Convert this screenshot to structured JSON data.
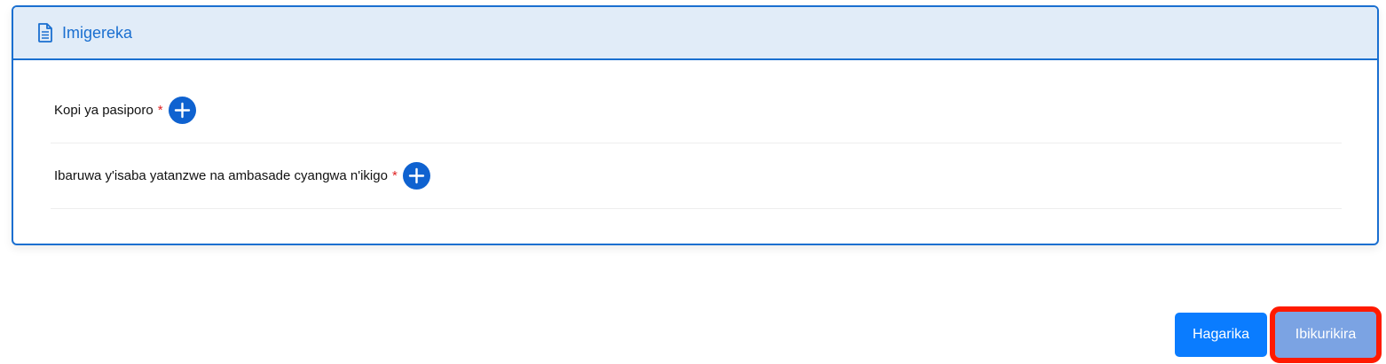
{
  "section": {
    "title": "Imigereka",
    "icon": "document-icon"
  },
  "documents": [
    {
      "label": "Kopi ya pasiporo",
      "required_marker": "*",
      "action_icon": "plus-circle-icon"
    },
    {
      "label": "Ibaruwa y'isaba yatanzwe na ambasade cyangwa n'ikigo",
      "required_marker": "*",
      "action_icon": "plus-circle-icon"
    }
  ],
  "actions": {
    "cancel_label": "Hagarika",
    "next_label": "Ibikurikira"
  },
  "colors": {
    "accent": "#1a6fd0",
    "header_bg": "#e1ecf8",
    "required": "#e02424",
    "cancel_bg": "#0a7cff",
    "next_bg": "#7ba3e3",
    "highlight": "#ff1a00"
  }
}
